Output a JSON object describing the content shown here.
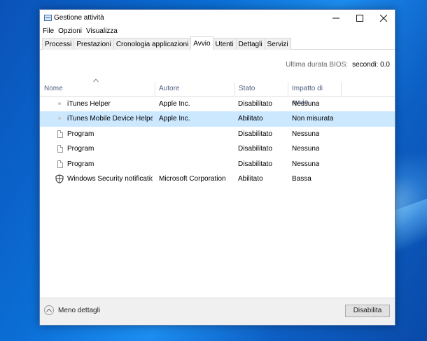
{
  "window": {
    "title": "Gestione attività",
    "controls": {
      "minimize": "—",
      "maximize": "☐",
      "close": "✕"
    }
  },
  "menubar": [
    "File",
    "Opzioni",
    "Visualizza"
  ],
  "tabs": [
    "Processi",
    "Prestazioni",
    "Cronologia applicazioni",
    "Avvio",
    "Utenti",
    "Dettagli",
    "Servizi"
  ],
  "active_tab": "Avvio",
  "bios": {
    "label": "Ultima durata BIOS:",
    "value": "secondi: 0.0"
  },
  "table": {
    "headers": [
      "Nome",
      "Autore",
      "Stato",
      "Impatto di avvio"
    ],
    "rows": [
      {
        "icon": "itunes-helper-icon",
        "name": "iTunes Helper",
        "publisher": "Apple Inc.",
        "status": "Disabilitato",
        "impact": "Nessuna",
        "selected": false
      },
      {
        "icon": "itunes-helper-icon",
        "name": "iTunes Mobile Device Helper",
        "publisher": "Apple Inc.",
        "status": "Abilitato",
        "impact": "Non misurata",
        "selected": true
      },
      {
        "icon": "document-icon",
        "name": "Program",
        "publisher": "",
        "status": "Disabilitato",
        "impact": "Nessuna",
        "selected": false
      },
      {
        "icon": "document-icon",
        "name": "Program",
        "publisher": "",
        "status": "Disabilitato",
        "impact": "Nessuna",
        "selected": false
      },
      {
        "icon": "document-icon",
        "name": "Program",
        "publisher": "",
        "status": "Disabilitato",
        "impact": "Nessuna",
        "selected": false
      },
      {
        "icon": "shield-icon",
        "name": "Windows Security notificatio...",
        "publisher": "Microsoft Corporation",
        "status": "Abilitato",
        "impact": "Bassa",
        "selected": false
      }
    ]
  },
  "footer": {
    "less_details": "Meno dettagli",
    "disable_button": "Disabilita"
  },
  "colors": {
    "selection": "#cce8ff",
    "header_text": "#4d6082",
    "desktop": "#0b6fd6"
  }
}
